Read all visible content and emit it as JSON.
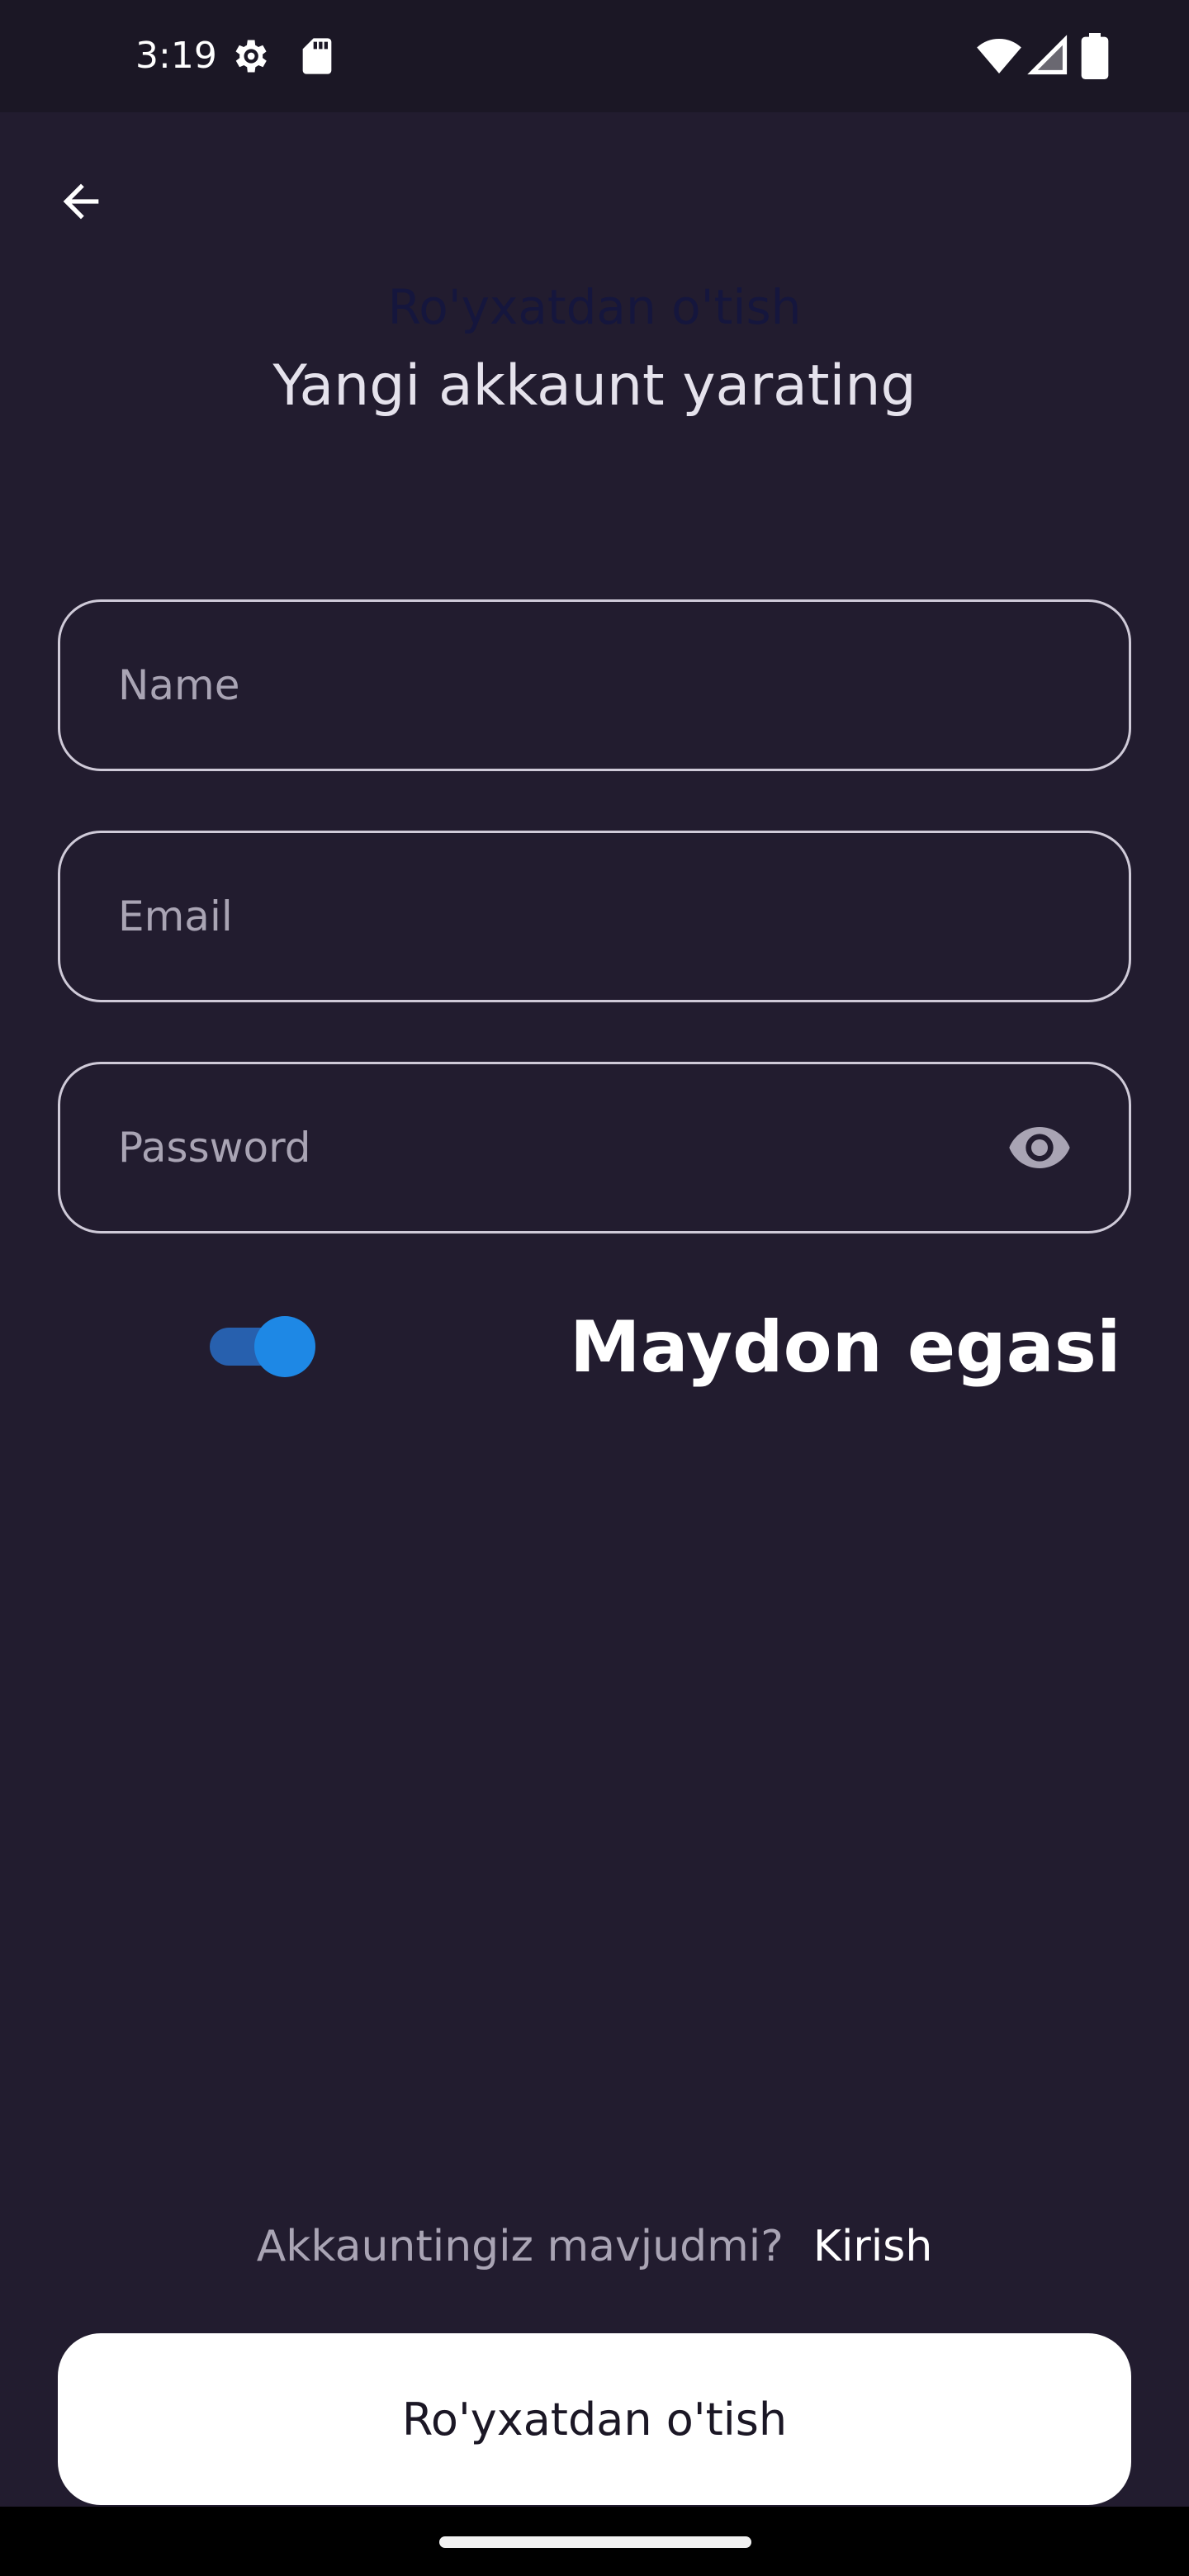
{
  "status_bar": {
    "time": "3:19",
    "icons": [
      "settings-gear-icon",
      "sd-card-icon",
      "wifi-icon",
      "signal-icon",
      "battery-icon"
    ]
  },
  "header": {
    "back_icon": "arrow-back-icon",
    "title": "Ro'yxatdan o'tish",
    "subtitle": "Yangi akkaunt yarating"
  },
  "form": {
    "name": {
      "placeholder": "Name",
      "value": ""
    },
    "email": {
      "placeholder": "Email",
      "value": ""
    },
    "password": {
      "placeholder": "Password",
      "value": "",
      "toggle_icon": "eye-icon"
    }
  },
  "owner_toggle": {
    "label": "Maydon egasi",
    "checked": true
  },
  "footer": {
    "login_prompt": "Akkauntingiz mavjudmi?",
    "login_link": "Kirish",
    "submit_label": "Ro'yxatdan o'tish"
  },
  "colors": {
    "background": "#221C2F",
    "status_bar": "#1B1725",
    "accent": "#1E88E5",
    "field_border": "#CFCAD8",
    "title_dim": "#15163D"
  }
}
